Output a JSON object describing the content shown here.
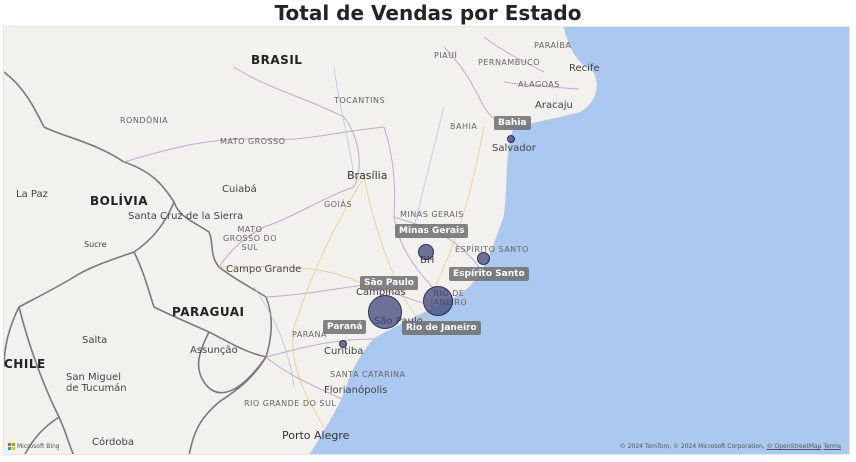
{
  "title": "Total de Vendas por Estado",
  "map": {
    "countries": [
      "BRASIL",
      "BOLÍVIA",
      "PARAGUAI",
      "CHILE"
    ],
    "states": [
      "PIAUÍ",
      "PARAÍBA",
      "PERNAMBUCO",
      "ALAGOAS",
      "TOCANTINS",
      "BAHIA",
      "RONDÔNIA",
      "MATO GROSSO",
      "GOIÁS",
      "MINAS GERAIS",
      "MATO GROSSO DO SUL",
      "ESPÍRITO SANTO",
      "RIO DE JANEIRO",
      "PARANÁ",
      "SANTA CATARINA",
      "RIO GRANDE DO SUL"
    ],
    "cities": [
      "Recife",
      "Aracaju",
      "Salvador",
      "Brasília",
      "Cuiabá",
      "La Paz",
      "Santa Cruz de la Sierra",
      "Sucre",
      "Campo Grande",
      "BH",
      "Campinas",
      "São Paulo",
      "Curitiba",
      "Salta",
      "Assunção",
      "San Miguel de Tucumán",
      "Florianópolis",
      "Porto Alegre",
      "Córdoba"
    ],
    "bubbles": [
      {
        "state": "Bahia",
        "size": 1
      },
      {
        "state": "Minas Gerais",
        "size": 3
      },
      {
        "state": "Espírito Santo",
        "size": 2
      },
      {
        "state": "São Paulo",
        "size": 5
      },
      {
        "state": "Rio de Janeiro",
        "size": 4
      },
      {
        "state": "Paraná",
        "size": 1
      }
    ],
    "attribution": "© 2024 TomTom, © 2024 Microsoft Corporation,",
    "attribution_link": "© OpenStreetMap",
    "terms": "Terms",
    "logo_text": "Microsoft Bing"
  }
}
